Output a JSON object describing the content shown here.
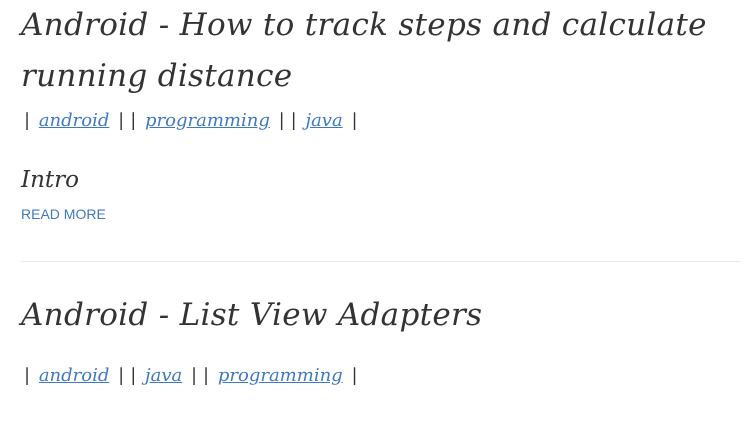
{
  "posts": [
    {
      "title": "Android - How to track steps and calculate running distance",
      "tags": [
        "android",
        "programming",
        "java"
      ],
      "intro": "Intro",
      "read_more": "READ MORE"
    },
    {
      "title": "Android - List View Adapters",
      "tags": [
        "android",
        "java",
        "programming"
      ]
    }
  ],
  "separators": {
    "pipe": "|"
  },
  "colors": {
    "text": "#333333",
    "link": "#3f79c0",
    "divider": "#e9e9e9"
  }
}
